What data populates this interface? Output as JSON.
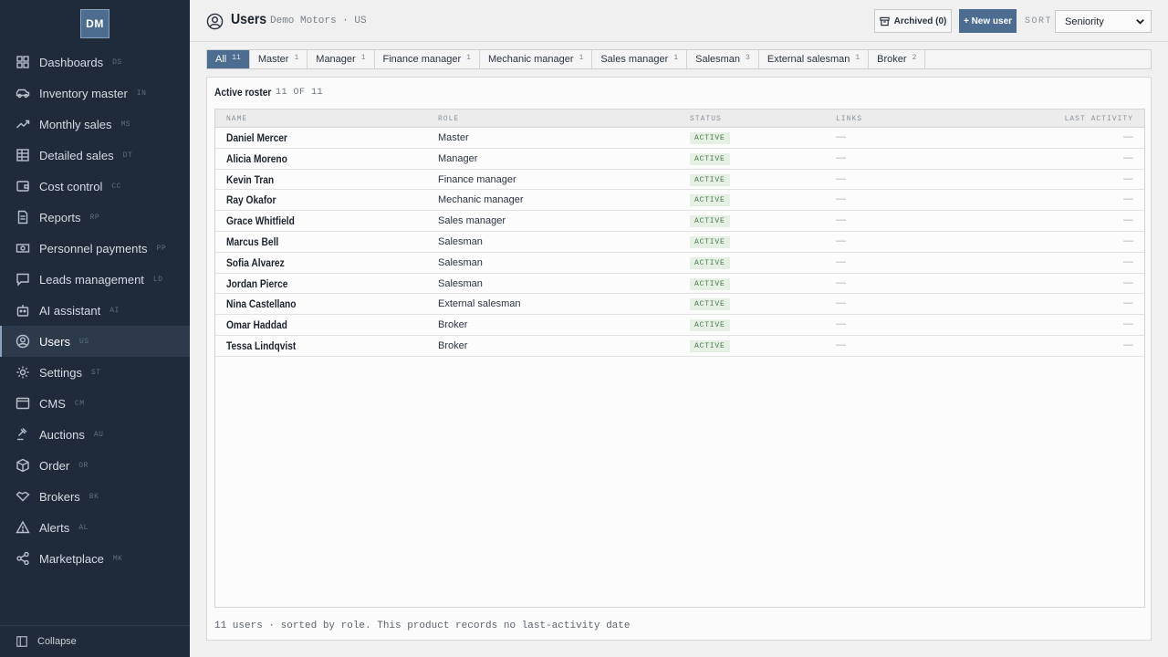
{
  "sidebar": {
    "logo": "DM",
    "items": [
      {
        "label": "Dashboards",
        "code": "DS",
        "icon": "grid-icon"
      },
      {
        "label": "Inventory master",
        "code": "IN",
        "icon": "car-icon"
      },
      {
        "label": "Monthly sales",
        "code": "MS",
        "icon": "trend-icon"
      },
      {
        "label": "Detailed sales",
        "code": "DT",
        "icon": "table-icon"
      },
      {
        "label": "Cost control",
        "code": "CC",
        "icon": "wallet-icon"
      },
      {
        "label": "Reports",
        "code": "RP",
        "icon": "document-icon"
      },
      {
        "label": "Personnel payments",
        "code": "PP",
        "icon": "money-icon"
      },
      {
        "label": "Leads management",
        "code": "LD",
        "icon": "chat-icon"
      },
      {
        "label": "AI assistant",
        "code": "AI",
        "icon": "robot-icon"
      },
      {
        "label": "Users",
        "code": "US",
        "icon": "user-circle-icon",
        "active": true
      },
      {
        "label": "Settings",
        "code": "ST",
        "icon": "gear-icon"
      },
      {
        "label": "CMS",
        "code": "CM",
        "icon": "browser-icon"
      },
      {
        "label": "Auctions",
        "code": "AU",
        "icon": "gavel-icon"
      },
      {
        "label": "Order",
        "code": "OR",
        "icon": "box-icon"
      },
      {
        "label": "Brokers",
        "code": "BK",
        "icon": "handshake-icon"
      },
      {
        "label": "Alerts",
        "code": "AL",
        "icon": "warning-icon"
      },
      {
        "label": "Marketplace",
        "code": "MK",
        "icon": "share-icon"
      }
    ],
    "collapse_label": "Collapse"
  },
  "header": {
    "title": "Users",
    "org": "Demo Motors · US",
    "archived_label": "Archived (0)",
    "new_user_label": "+ New user",
    "sort_label": "SORT",
    "sort_value": "Seniority"
  },
  "tabs": [
    {
      "label": "All",
      "count": "11",
      "active": true
    },
    {
      "label": "Master",
      "count": "1"
    },
    {
      "label": "Manager",
      "count": "1"
    },
    {
      "label": "Finance manager",
      "count": "1"
    },
    {
      "label": "Mechanic manager",
      "count": "1"
    },
    {
      "label": "Sales manager",
      "count": "1"
    },
    {
      "label": "Salesman",
      "count": "3"
    },
    {
      "label": "External salesman",
      "count": "1"
    },
    {
      "label": "Broker",
      "count": "2"
    }
  ],
  "panel": {
    "title": "Active roster",
    "count": "11 OF 11",
    "columns": {
      "name": "NAME",
      "role": "ROLE",
      "status": "STATUS",
      "links": "LINKS",
      "last_activity": "LAST ACTIVITY"
    },
    "rows": [
      {
        "name": "Daniel Mercer",
        "role": "Master",
        "status": "ACTIVE",
        "links": "—",
        "last": "—"
      },
      {
        "name": "Alicia Moreno",
        "role": "Manager",
        "status": "ACTIVE",
        "links": "—",
        "last": "—"
      },
      {
        "name": "Kevin Tran",
        "role": "Finance manager",
        "status": "ACTIVE",
        "links": "—",
        "last": "—"
      },
      {
        "name": "Ray Okafor",
        "role": "Mechanic manager",
        "status": "ACTIVE",
        "links": "—",
        "last": "—"
      },
      {
        "name": "Grace Whitfield",
        "role": "Sales manager",
        "status": "ACTIVE",
        "links": "—",
        "last": "—"
      },
      {
        "name": "Marcus Bell",
        "role": "Salesman",
        "status": "ACTIVE",
        "links": "—",
        "last": "—"
      },
      {
        "name": "Sofia Alvarez",
        "role": "Salesman",
        "status": "ACTIVE",
        "links": "—",
        "last": "—"
      },
      {
        "name": "Jordan Pierce",
        "role": "Salesman",
        "status": "ACTIVE",
        "links": "—",
        "last": "—"
      },
      {
        "name": "Nina Castellano",
        "role": "External salesman",
        "status": "ACTIVE",
        "links": "—",
        "last": "—"
      },
      {
        "name": "Omar Haddad",
        "role": "Broker",
        "status": "ACTIVE",
        "links": "—",
        "last": "—"
      },
      {
        "name": "Tessa Lindqvist",
        "role": "Broker",
        "status": "ACTIVE",
        "links": "—",
        "last": "—"
      }
    ],
    "footer": "11 users · sorted by role. This product records no last-activity date"
  }
}
